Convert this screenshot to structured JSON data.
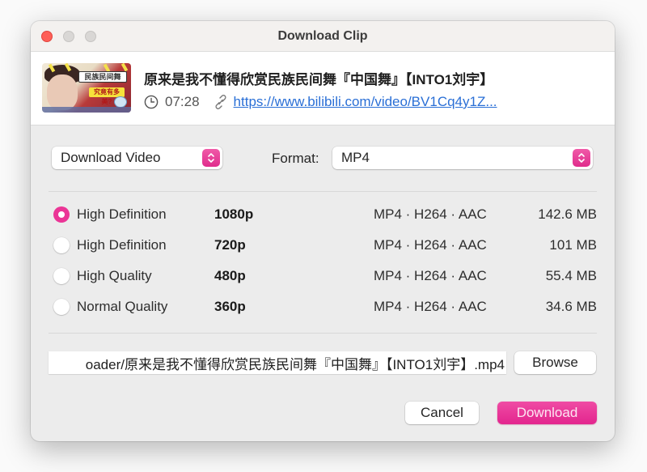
{
  "window": {
    "title": "Download Clip",
    "traffic_lights": [
      "close",
      "minimize",
      "zoom"
    ]
  },
  "clip": {
    "thumbnail_alt": "video thumbnail",
    "thumbnail_text_1": "民族民间舞",
    "thumbnail_text_2": "究竟有多美?",
    "title": "原来是我不懂得欣赏民族民间舞『中国舞』【INTO1刘宇】",
    "duration": "07:28",
    "url": "https://www.bilibili.com/video/BV1Cq4y1Z..."
  },
  "options": {
    "mode_selected": "Download Video",
    "format_label": "Format:",
    "format_selected": "MP4"
  },
  "qualities": [
    {
      "label": "High Definition",
      "resolution": "1080p",
      "codec": "MP4 · H264 · AAC",
      "size": "142.6 MB",
      "selected": true
    },
    {
      "label": "High Definition",
      "resolution": "720p",
      "codec": "MP4 · H264 · AAC",
      "size": "101 MB",
      "selected": false
    },
    {
      "label": "High Quality",
      "resolution": "480p",
      "codec": "MP4 · H264 · AAC",
      "size": "55.4 MB",
      "selected": false
    },
    {
      "label": "Normal Quality",
      "resolution": "360p",
      "codec": "MP4 · H264 · AAC",
      "size": "34.6 MB",
      "selected": false
    }
  ],
  "save": {
    "path_value": "oader/原来是我不懂得欣赏民族民间舞『中国舞』【INTO1刘宇】.mp4",
    "browse_label": "Browse"
  },
  "actions": {
    "cancel_label": "Cancel",
    "download_label": "Download"
  },
  "colors": {
    "accent": "#e6308f",
    "link": "#2a6fd6",
    "close_button": "#fe5f57"
  }
}
